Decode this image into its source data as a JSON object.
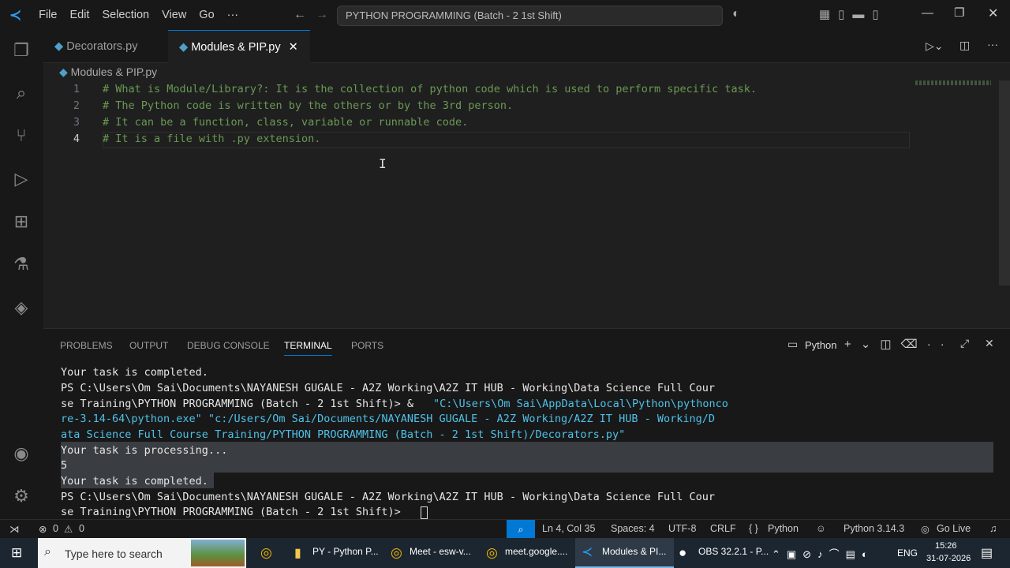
{
  "titlebar": {
    "menus": [
      "File",
      "Edit",
      "Selection",
      "View",
      "Go",
      "···"
    ],
    "search_text": "PYTHON PROGRAMMING (Batch - 2 1st Shift)"
  },
  "tabs": [
    {
      "label": "Decorators.py"
    },
    {
      "label": "Modules & PIP.py"
    }
  ],
  "breadcrumb": "Modules & PIP.py",
  "editor": {
    "lines": [
      {
        "num": "1",
        "text": "# What is Module/Library?: It is the collection of python code which is used to perform specific task."
      },
      {
        "num": "2",
        "text": "# The Python code is written by the others or by the 3rd person."
      },
      {
        "num": "3",
        "text": "# It can be a function, class, variable or runnable code."
      },
      {
        "num": "4",
        "text": "# It is a file with .py extension."
      }
    ]
  },
  "panel": {
    "tabs": [
      "PROBLEMS",
      "OUTPUT",
      "DEBUG CONSOLE",
      "TERMINAL",
      "PORTS"
    ],
    "shell": "Python",
    "terminal": [
      "Your task is completed.",
      "PS C:\\Users\\Om Sai\\Documents\\NAYANESH GUGALE - A2Z Working\\A2Z IT HUB - Working\\Data Science Full Cour",
      "se Training\\PYTHON PROGRAMMING (Batch - 2 1st Shift)> & ",
      "\"C:\\Users\\Om Sai\\AppData\\Local\\Python\\pythonco",
      "re-3.14-64\\python.exe\" \"c:/Users/Om Sai/Documents/NAYANESH GUGALE - A2Z Working/A2Z IT HUB - Working/D",
      "ata Science Full Course Training/PYTHON PROGRAMMING (Batch - 2 1st Shift)/Decorators.py\"",
      "Your task is processing...",
      "5",
      "Your task is completed.",
      "PS C:\\Users\\Om Sai\\Documents\\NAYANESH GUGALE - A2Z Working\\A2Z IT HUB - Working\\Data Science Full Cour",
      "se Training\\PYTHON PROGRAMMING (Batch - 2 1st Shift)> "
    ]
  },
  "status": {
    "errors": "0",
    "warnings": "0",
    "position": "Ln 4, Col 35",
    "spaces": "Spaces: 4",
    "encoding": "UTF-8",
    "eol": "CRLF",
    "language": "Python",
    "interpreter": "Python 3.14.3",
    "golive": "Go Live"
  },
  "taskbar": {
    "search_placeholder": "Type here to search",
    "apps": [
      "PY - Python P...",
      "Meet - esw-v...",
      "meet.google....",
      "Modules & PI...",
      "OBS 32.2.1 - P..."
    ],
    "lang": "ENG",
    "time": "15:26",
    "date": "31-07-2026"
  },
  "colors": {
    "accent": "#0078d4",
    "comment": "#6a9955"
  }
}
